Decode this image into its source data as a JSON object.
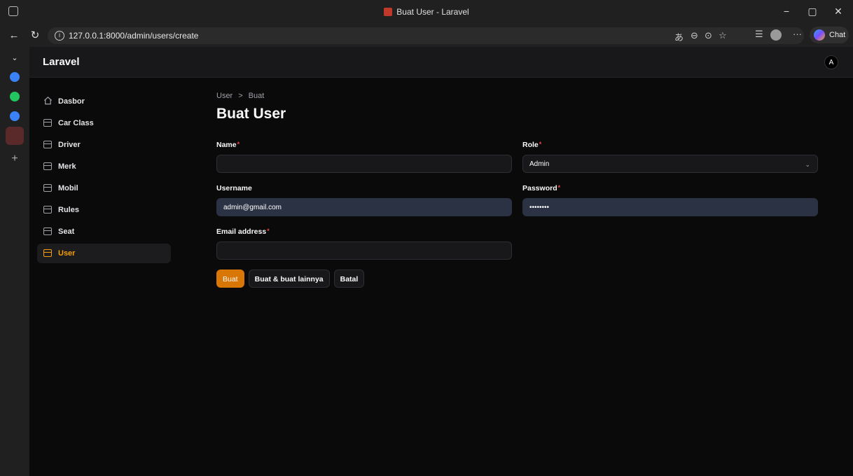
{
  "browser": {
    "window_title": "Buat User - Laravel",
    "url": "127.0.0.1:8000/admin/users/create",
    "chat_label": "Chat"
  },
  "app": {
    "brand": "Laravel",
    "avatar_initial": "A",
    "accent_color": "#d97706"
  },
  "sidebar": {
    "items": [
      {
        "label": "Dasbor",
        "icon": "home-icon"
      },
      {
        "label": "Car Class",
        "icon": "folder-icon"
      },
      {
        "label": "Driver",
        "icon": "folder-icon"
      },
      {
        "label": "Merk",
        "icon": "folder-icon"
      },
      {
        "label": "Mobil",
        "icon": "folder-icon"
      },
      {
        "label": "Rules",
        "icon": "folder-icon"
      },
      {
        "label": "Seat",
        "icon": "folder-icon"
      },
      {
        "label": "User",
        "icon": "folder-icon",
        "active": true
      }
    ]
  },
  "main": {
    "breadcrumb": [
      "User",
      "Buat"
    ],
    "title": "Buat User",
    "fields": {
      "name": {
        "label": "Name",
        "required": "*",
        "value": ""
      },
      "role": {
        "label": "Role",
        "required": "*",
        "value": "Admin"
      },
      "username": {
        "label": "Username",
        "value": "admin@gmail.com"
      },
      "password": {
        "label": "Password",
        "required": "*",
        "value": "••••••••"
      },
      "email": {
        "label": "Email address",
        "required": "*",
        "value": ""
      }
    },
    "actions": {
      "create": "Buat",
      "create_another": "Buat & buat lainnya",
      "cancel": "Batal"
    }
  }
}
